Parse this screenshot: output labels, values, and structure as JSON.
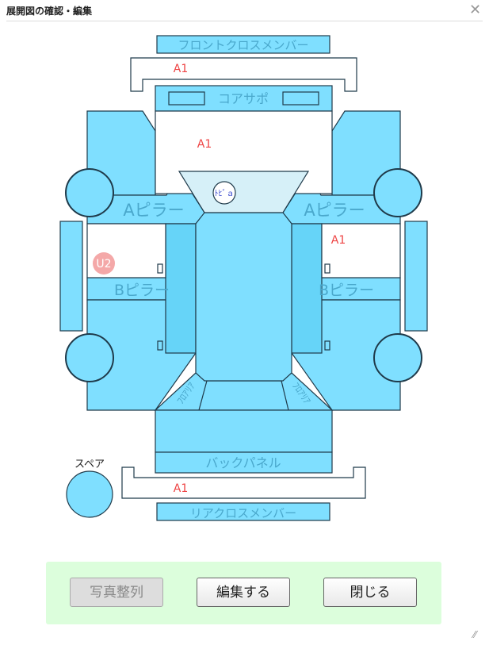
{
  "window": {
    "title": "展開図の確認・編集",
    "close_symbol": "✕"
  },
  "parts": {
    "front_cross_member": "フロントクロスメンバー",
    "core_support": "コアサポ",
    "a_pillar_left": "Aピラー",
    "a_pillar_right": "Aピラー",
    "b_pillar_left": "Bピラー",
    "b_pillar_right": "Bピラー",
    "back_panel": "バックパネル",
    "rear_cross_member": "リアクロスメンバー",
    "spare": "スペア",
    "toe_board": "ﾄﾋﾞａ",
    "floor_left": "ﾌﾛｱﾘｱ",
    "floor_right": "ﾌﾛｱﾘｱ"
  },
  "markers": {
    "front_cross": "A1",
    "hood_area": "A1",
    "right_side": "A1",
    "rear_cross": "A1",
    "left_side": "U2"
  },
  "colors": {
    "panel": "#7fdfff",
    "panel_dark": "#66d4f8",
    "stroke": "#1f3a4a",
    "marker_text": "#ee4444",
    "marker_badge": "#f4a8a8",
    "toe": "#d6f0f8"
  },
  "buttons": {
    "arrange": "写真整列",
    "edit": "編集する",
    "close": "閉じる"
  },
  "resize_symbol": "⁄⁄"
}
